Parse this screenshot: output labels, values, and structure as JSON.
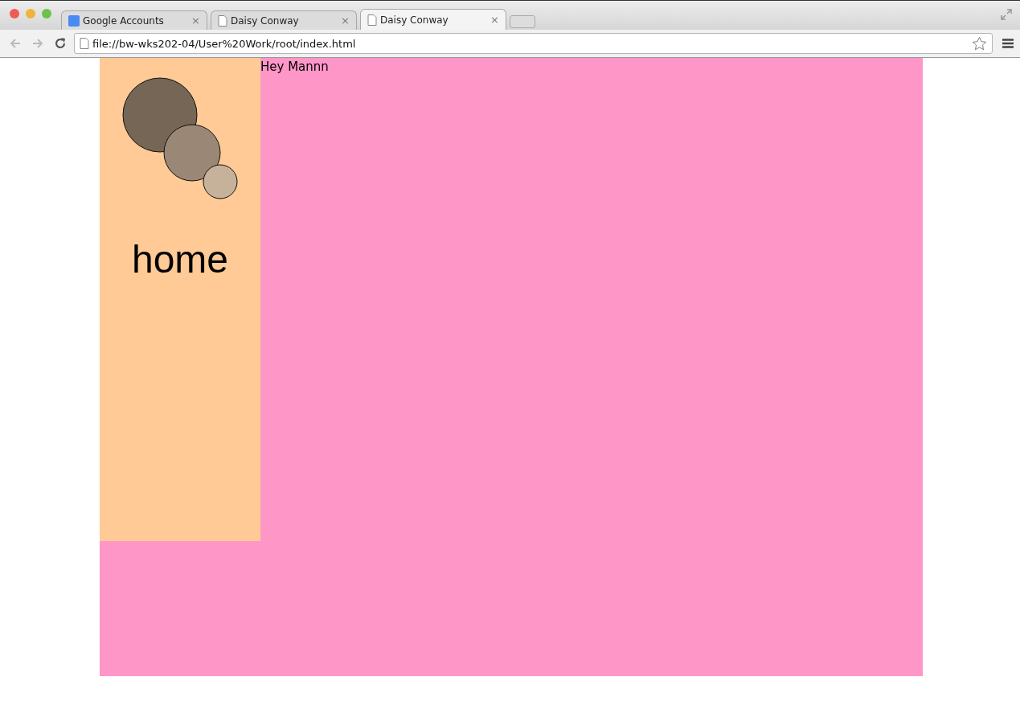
{
  "browser": {
    "tabs": [
      {
        "title": "Google Accounts",
        "kind": "google",
        "close": "×",
        "selected": false
      },
      {
        "title": "Daisy Conway",
        "kind": "page",
        "close": "×",
        "selected": false
      },
      {
        "title": "Daisy Conway",
        "kind": "page",
        "close": "×",
        "selected": true
      }
    ],
    "address": "file://bw-wks202-04/User%20Work/root/index.html"
  },
  "page": {
    "nav_link": "home",
    "greeting": "Hey Mannn"
  }
}
